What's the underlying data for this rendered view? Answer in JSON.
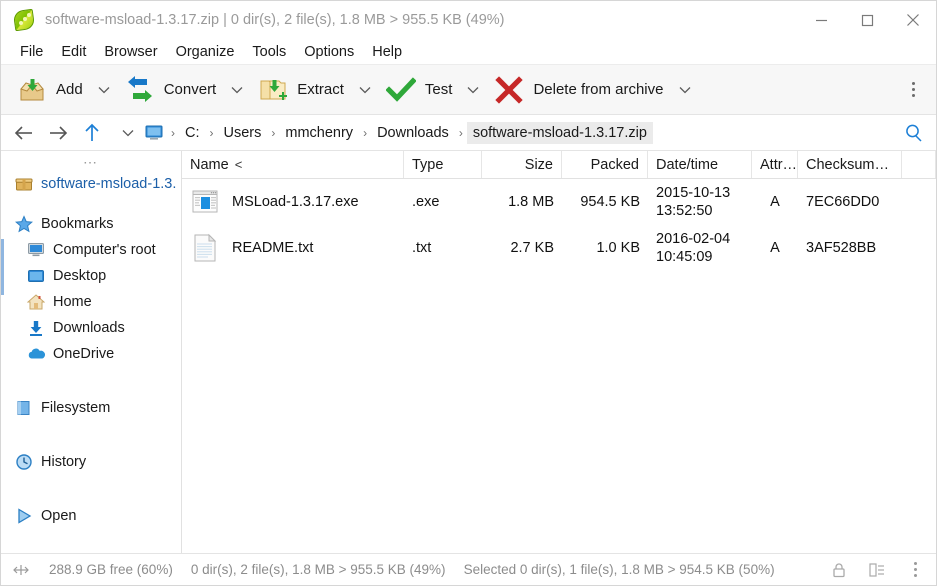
{
  "window": {
    "title": "software-msload-1.3.17.zip | 0 dir(s), 2 file(s), 1.8 MB > 955.5 KB (49%)",
    "app_icon": "peazip-pod-icon",
    "minimize_label": "Minimize",
    "maximize_label": "Maximize",
    "close_label": "Close"
  },
  "menubar": {
    "items": [
      {
        "label": "File"
      },
      {
        "label": "Edit"
      },
      {
        "label": "Browser"
      },
      {
        "label": "Organize"
      },
      {
        "label": "Tools"
      },
      {
        "label": "Options"
      },
      {
        "label": "Help"
      }
    ]
  },
  "toolbar": {
    "buttons": [
      {
        "label": "Add",
        "icon": "add-box-icon",
        "has_caret": true
      },
      {
        "label": "Convert",
        "icon": "convert-arrows-icon",
        "has_caret": true
      },
      {
        "label": "Extract",
        "icon": "extract-folder-icon",
        "has_caret": true
      },
      {
        "label": "Test",
        "icon": "check-mark-icon",
        "has_caret": true
      },
      {
        "label": "Delete from archive",
        "icon": "red-x-icon",
        "has_caret": true
      }
    ],
    "overflow_label": "More toolbar options"
  },
  "addressbar": {
    "back_label": "Back",
    "forward_label": "Forward",
    "up_label": "Up one level",
    "history_caret_label": "History dropdown",
    "root_icon": "computer-monitor-icon",
    "crumbs": [
      {
        "label": "C:",
        "current": false
      },
      {
        "label": "Users",
        "current": false
      },
      {
        "label": "mmchenry",
        "current": false
      },
      {
        "label": "Downloads",
        "current": false
      },
      {
        "label": "software-msload-1.3.17.zip",
        "current": true
      }
    ],
    "separator": "›",
    "search_label": "Search"
  },
  "sidebar": {
    "overflow_dots": "⋯",
    "archive": {
      "label": "software-msload-1.3.",
      "icon": "archive-box-icon"
    },
    "sections": [
      {
        "header": {
          "label": "Bookmarks",
          "icon": "star-icon"
        },
        "items": [
          {
            "label": "Computer's root",
            "icon": "computer-monitor-icon"
          },
          {
            "label": "Desktop",
            "icon": "desktop-screen-icon"
          },
          {
            "label": "Home",
            "icon": "home-house-icon"
          },
          {
            "label": "Downloads",
            "icon": "download-arrow-icon"
          },
          {
            "label": "OneDrive",
            "icon": "cloud-icon"
          }
        ]
      }
    ],
    "standalone": [
      {
        "label": "Filesystem",
        "icon": "filesystem-folder-icon"
      },
      {
        "label": "History",
        "icon": "clock-icon"
      },
      {
        "label": "Open",
        "icon": "play-triangle-icon"
      }
    ]
  },
  "filelist": {
    "columns": [
      {
        "key": "name",
        "label": "Name",
        "sort": "<"
      },
      {
        "key": "type",
        "label": "Type"
      },
      {
        "key": "size",
        "label": "Size"
      },
      {
        "key": "packed",
        "label": "Packed"
      },
      {
        "key": "date",
        "label": "Date/time"
      },
      {
        "key": "attr",
        "label": "Attr…"
      },
      {
        "key": "checksum",
        "label": "Checksum…"
      }
    ],
    "rows": [
      {
        "name": "MSLoad-1.3.17.exe",
        "icon": "exe-application-icon",
        "type": ".exe",
        "size": "1.8 MB",
        "packed": "954.5 KB",
        "date": "2015-10-13",
        "time": "13:52:50",
        "attr": "A",
        "checksum": "7EC66DD0"
      },
      {
        "name": "README.txt",
        "icon": "text-document-icon",
        "type": ".txt",
        "size": "2.7 KB",
        "packed": "1.0 KB",
        "date": "2016-02-04",
        "time": "10:45:09",
        "attr": "A",
        "checksum": "3AF528BB"
      }
    ]
  },
  "statusbar": {
    "resize_icon": "resize-handle-icon",
    "free_space": "288.9 GB free (60%)",
    "archive_summary": "0 dir(s), 2 file(s), 1.8 MB > 955.5 KB (49%)",
    "selection_summary": "Selected 0 dir(s), 1 file(s), 1.8 MB > 954.5 KB (50%)",
    "lock_icon": "padlock-icon",
    "view_icon": "list-view-icon",
    "menu_icon": "vertical-dots-icon"
  },
  "colors": {
    "accent_blue": "#1c7fd6",
    "crumb_selected_bg": "#ebebeb",
    "toolbar_bg": "#f7f7f7",
    "status_text": "#8c8c8c",
    "title_text": "#9a9a9a",
    "red": "#c62828",
    "green": "#2fa83a"
  }
}
